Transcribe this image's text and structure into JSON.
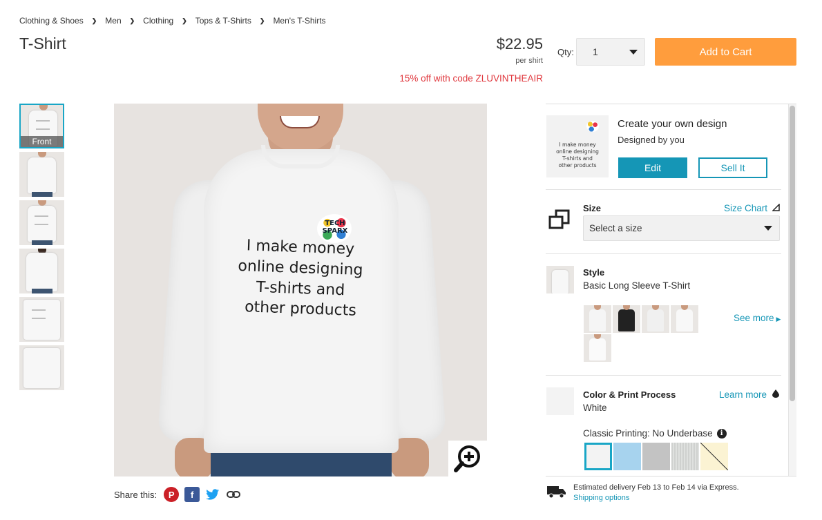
{
  "breadcrumb": [
    "Clothing & Shoes",
    "Men",
    "Clothing",
    "Tops & T-Shirts",
    "Men's T-Shirts"
  ],
  "product": {
    "title": "T-Shirt",
    "price": "$22.95",
    "per_unit": "per shirt",
    "promo": "15% off with code ZLUVINTHEAIR"
  },
  "purchase": {
    "qty_label": "Qty:",
    "qty_value": "1",
    "add_to_cart": "Add to Cart"
  },
  "gallery": {
    "thumbnails": [
      "Front",
      "",
      "",
      "",
      "",
      ""
    ],
    "active_label": "Front",
    "print_lines": [
      "I make money",
      "online designing",
      "T-shirts and",
      "other products"
    ],
    "logo_text": [
      "TECH",
      "SPARX"
    ]
  },
  "share": {
    "label": "Share this:",
    "icons": [
      "pinterest-icon",
      "facebook-icon",
      "twitter-icon",
      "link-icon"
    ]
  },
  "customize": {
    "design_lines": [
      "I make money",
      "online designing",
      "T-shirts and",
      "other products"
    ],
    "title": "Create your own design",
    "subtitle": "Designed by you",
    "edit_label": "Edit",
    "sell_label": "Sell It"
  },
  "size": {
    "label": "Size",
    "chart_link": "Size Chart",
    "placeholder": "Select a size"
  },
  "style": {
    "label": "Style",
    "value": "Basic Long Sleeve T-Shirt",
    "see_more": "See more",
    "options": [
      {
        "shirt": "#f5f5f5"
      },
      {
        "shirt": "#222222"
      },
      {
        "shirt": "#f0f0f0"
      },
      {
        "shirt": "#f8f8f8"
      },
      {
        "shirt": "#fafafa"
      }
    ]
  },
  "color": {
    "label": "Color & Print Process",
    "value": "White",
    "learn_more": "Learn more",
    "process": "Classic Printing: No Underbase",
    "swatches": [
      "#f3f3f3",
      "#a7d3ee",
      "#c3c3c3",
      "#d6d8d6",
      "#fbf3d3"
    ]
  },
  "delivery": {
    "text": "Estimated delivery Feb 13 to Feb 14 via Express.",
    "link": "Shipping options"
  },
  "colors": {
    "accent": "#1596b6",
    "cta": "#ff9d3d",
    "promo": "#e0383e"
  }
}
